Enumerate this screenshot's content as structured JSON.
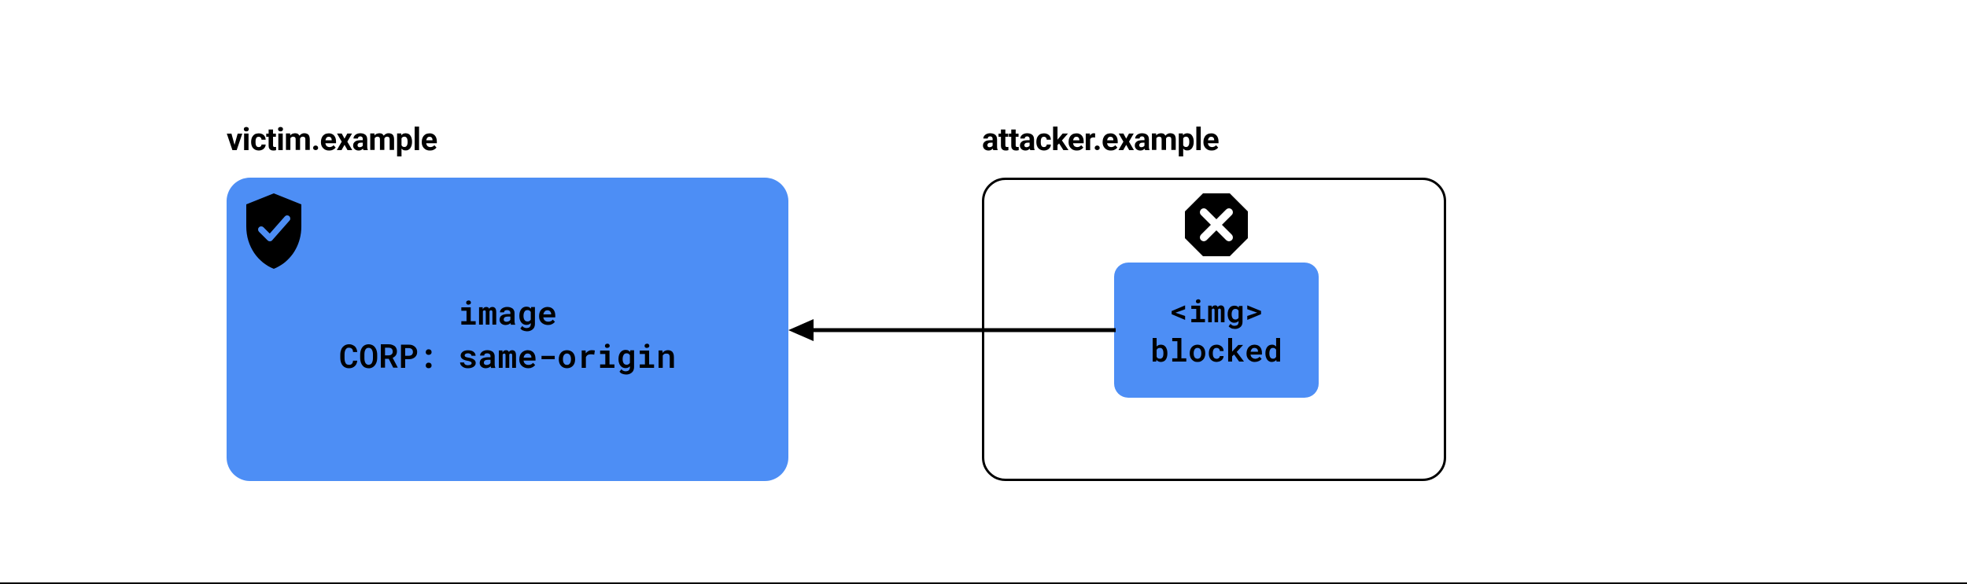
{
  "victim": {
    "title": "victim.example",
    "line1": "image",
    "line2": "CORP: same-origin"
  },
  "attacker": {
    "title": "attacker.example",
    "inner_line1": "<img>",
    "inner_line2": "blocked"
  },
  "colors": {
    "blue": "#4d8ef5",
    "text": "#000000"
  }
}
